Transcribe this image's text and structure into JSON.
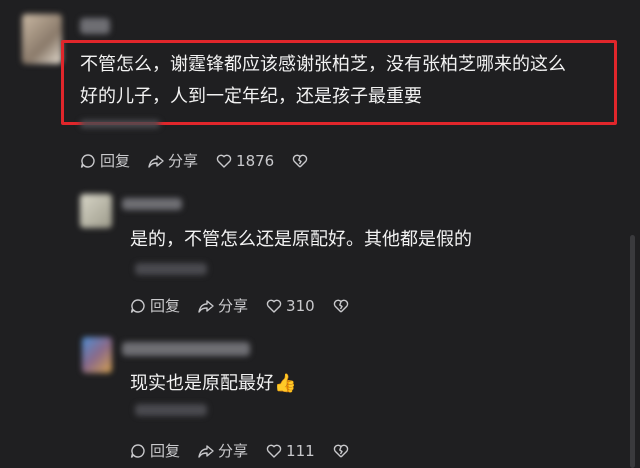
{
  "comments": [
    {
      "text_line1": "不管怎么，谢霆锋都应该感谢张柏芝，没有张柏芝哪来的这么",
      "text_line2": "好的儿子，人到一定年纪，还是孩子最重要",
      "reply_label": "回复",
      "share_label": "分享",
      "likes": "1876"
    },
    {
      "text": "是的，不管怎么还是原配好。其他都是假的",
      "reply_label": "回复",
      "share_label": "分享",
      "likes": "310"
    },
    {
      "text": "现实也是原配最好",
      "emoji": "👍",
      "reply_label": "回复",
      "share_label": "分享",
      "likes": "111"
    }
  ],
  "colors": {
    "highlight_border": "#e0262b",
    "background": "#1f1f21"
  }
}
